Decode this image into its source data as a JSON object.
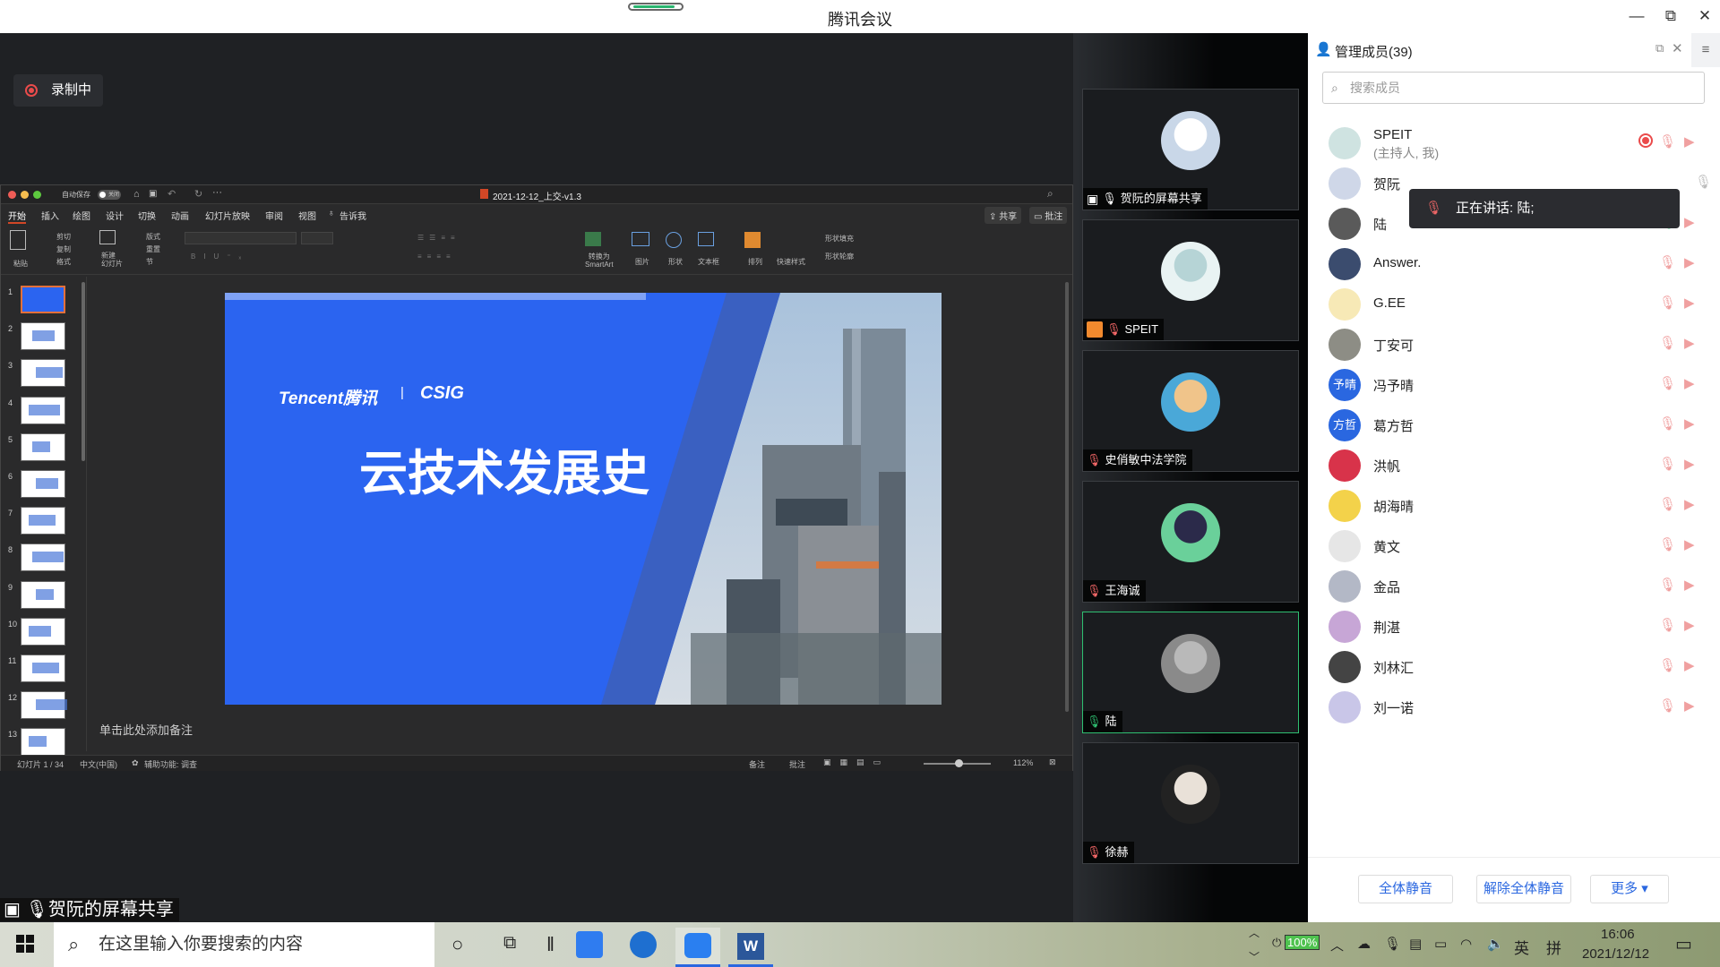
{
  "window": {
    "title": "腾讯会议",
    "min": "—",
    "max": "⧉",
    "close": "✕"
  },
  "recording": {
    "label": "录制中"
  },
  "ppt": {
    "autosave": "自动保存",
    "autosave_state": "关闭",
    "filename": "2021-12-12_上交-v1.3",
    "menu": [
      "开始",
      "插入",
      "绘图",
      "设计",
      "切换",
      "动画",
      "幻灯片放映",
      "审阅",
      "视图",
      "告诉我"
    ],
    "share_btn": "共享",
    "comment_btn": "批注",
    "ribbon": {
      "paste": "粘贴",
      "cut": "剪切",
      "copy": "复制",
      "format": "格式",
      "new_slide": "新建\n幻灯片",
      "layout": "版式",
      "reset": "重置",
      "section": "节",
      "to_smartart": "转换为\nSmartArt",
      "picture": "图片",
      "shape": "形状",
      "textbox": "文本框",
      "arrange": "排列",
      "quick_style": "快速样式",
      "shape_fill": "形状填充",
      "shape_outline": "形状轮廓"
    },
    "thumb_numbers": [
      "1",
      "2",
      "3",
      "4",
      "5",
      "6",
      "7",
      "8",
      "9",
      "10",
      "11",
      "12",
      "13"
    ],
    "slide": {
      "brand_left": "Tencent腾讯",
      "brand_sep": "|",
      "brand_right": "CSIG",
      "title": "云技术发展史"
    },
    "notes_placeholder": "单击此处添加备注",
    "status": {
      "slide_pos": "幻灯片 1 / 34",
      "lang": "中文(中国)",
      "accessibility": "辅助功能: 调查",
      "notes": "备注",
      "comments": "批注",
      "zoom": "112%"
    }
  },
  "share_label": "贺阮的屏幕共享",
  "gallery": [
    {
      "name": "贺阮的屏幕共享",
      "mic": "on",
      "screen": true
    },
    {
      "name": "SPEIT",
      "mic": "off",
      "host": true
    },
    {
      "name": "史俏敏中法学院",
      "mic": "off"
    },
    {
      "name": "王海诚",
      "mic": "off"
    },
    {
      "name": "陆",
      "mic": "on",
      "active": true
    },
    {
      "name": "徐赫",
      "mic": "off"
    }
  ],
  "panel": {
    "title": "管理成员(39)",
    "search_placeholder": "搜索成员",
    "speaking_tooltip": "正在讲话: 陆;",
    "members": [
      {
        "name": "SPEIT",
        "sub": "(主持人, 我)",
        "rec": true
      },
      {
        "name": "贺阮"
      },
      {
        "name": "陆",
        "mic_on": true
      },
      {
        "name": "Answer."
      },
      {
        "name": "G.EE"
      },
      {
        "name": "丁安可"
      },
      {
        "name": "冯予晴",
        "avatar_text": "予晴"
      },
      {
        "name": "葛方哲",
        "avatar_text": "方哲"
      },
      {
        "name": "洪帆"
      },
      {
        "name": "胡海晴"
      },
      {
        "name": "黄文"
      },
      {
        "name": "金品"
      },
      {
        "name": "荆湛"
      },
      {
        "name": "刘林汇"
      },
      {
        "name": "刘一诺"
      }
    ],
    "buttons": {
      "mute_all": "全体静音",
      "unmute_all": "解除全体静音",
      "more": "更多 ▾"
    }
  },
  "taskbar": {
    "search_placeholder": "在这里输入你要搜索的内容",
    "battery": "100%",
    "ime_lang": "英",
    "ime_mode": "拼",
    "time": "16:06",
    "date": "2021/12/12"
  },
  "colors": {
    "accent": "#2a67e0",
    "slide_blue": "#2b64f0",
    "active_green": "#2fbf71",
    "rec_red": "#ea4b4b"
  }
}
